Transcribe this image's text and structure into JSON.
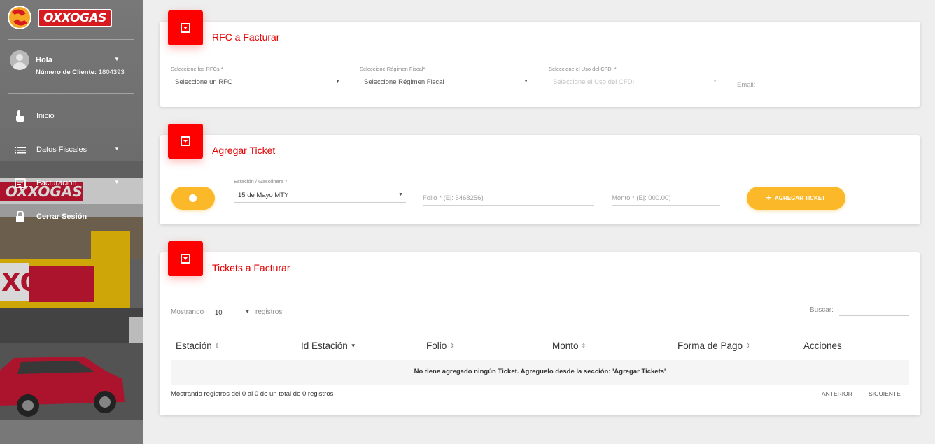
{
  "brand": {
    "logo_text": "OXXOGAS",
    "color_primary": "#ff0000",
    "color_accent": "#fbb829"
  },
  "sidebar": {
    "greeting": "Hola",
    "client_label": "Número de Cliente:",
    "client_number": "1804393",
    "items": [
      {
        "label": "Inicio",
        "icon": "hand-pointer-icon"
      },
      {
        "label": "Datos Fiscales",
        "icon": "list-icon",
        "has_submenu": true
      },
      {
        "label": "Facturación",
        "icon": "invoice-icon",
        "has_submenu": true
      },
      {
        "label": "Cerrar Sesión",
        "icon": "lock-icon"
      }
    ]
  },
  "rfc_card": {
    "title": "RFC a Facturar",
    "rfc_label": "Seleccione los RFCs *",
    "rfc_value": "Seleccione un RFC",
    "regimen_label": "Seleccione Régimen Fiscal*",
    "regimen_value": "Seleccione Régimen Fiscal",
    "cfdi_label": "Seleccione el Uso del CFDI *",
    "cfdi_value": "Seleccione el Uso del CFDI",
    "email_placeholder": "Email:"
  },
  "ticket_card": {
    "title": "Agregar Ticket",
    "station_label": "Estación / Gasolinera *",
    "station_value": "15 de Mayo MTY",
    "folio_placeholder": "Folio * (Ej: 5468256)",
    "monto_placeholder": "Monto * (Ej: 000.00)",
    "add_button": "AGREGAR TICKET"
  },
  "tickets_table": {
    "title": "Tickets a Facturar",
    "show_prefix": "Mostrando",
    "page_length": "10",
    "show_suffix": "registros",
    "search_label": "Buscar:",
    "columns": [
      {
        "label": "Estación",
        "sort": "⇕"
      },
      {
        "label": "Id Estación",
        "sort": "▼"
      },
      {
        "label": "Folio",
        "sort": "⇕"
      },
      {
        "label": "Monto",
        "sort": "⇕"
      },
      {
        "label": "Forma de Pago",
        "sort": "⇕"
      },
      {
        "label": "Acciones",
        "sort": ""
      }
    ],
    "empty_message": "No tiene agregado ningún Ticket. Agreguelo desde la sección: 'Agregar Tickets'",
    "info": "Mostrando registros del 0 al 0 de un total de 0 registros",
    "prev": "ANTERIOR",
    "next": "SIGUIENTE"
  }
}
